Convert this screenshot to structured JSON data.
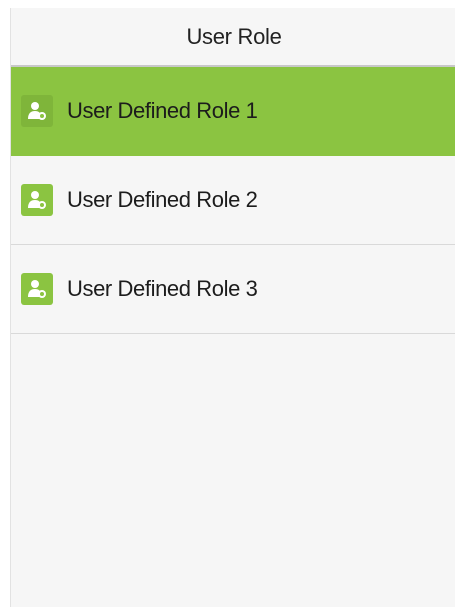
{
  "header": {
    "title": "User Role"
  },
  "roles": [
    {
      "label": "User Defined Role 1",
      "selected": true,
      "icon": "user-role-icon"
    },
    {
      "label": "User Defined Role 2",
      "selected": false,
      "icon": "user-role-icon"
    },
    {
      "label": "User Defined Role 3",
      "selected": false,
      "icon": "user-role-icon"
    }
  ],
  "colors": {
    "accent": "#8bc441",
    "background": "#f6f6f6",
    "divider": "#d9d9d9"
  }
}
